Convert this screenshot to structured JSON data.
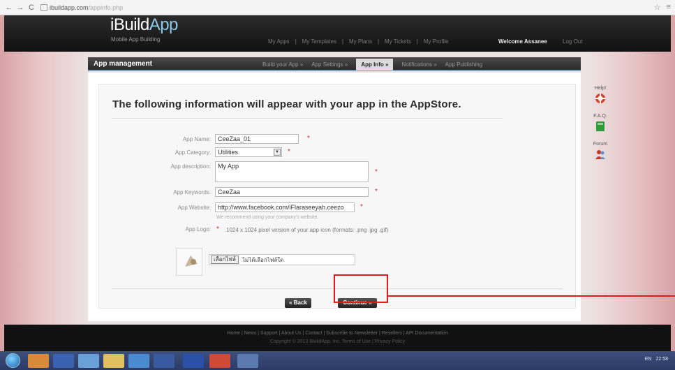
{
  "browser": {
    "url_host": "ibuildapp.com",
    "url_path": "/appinfo.php",
    "back_glyph": "←",
    "forward_glyph": "→",
    "reload_glyph": "C",
    "star_glyph": "☆",
    "menu_glyph": "≡"
  },
  "site": {
    "logo_main": "iBuild",
    "logo_accent": "App",
    "logo_sub": "Mobile App Building",
    "top_links": [
      "My Apps",
      "My Templates",
      "My Plans",
      "My Tickets",
      "My Profile"
    ],
    "welcome": "Welcome Assanee",
    "logout": "Log Out"
  },
  "management": {
    "title": "App management",
    "steps": [
      {
        "label": "Build your App »",
        "active": false
      },
      {
        "label": "App Settings »",
        "active": false
      },
      {
        "label": "App Info »",
        "active": true
      },
      {
        "label": "Notifications »",
        "active": false
      },
      {
        "label": "App Publishing",
        "active": false
      }
    ]
  },
  "form": {
    "heading": "The following information will appear with your app in the AppStore.",
    "app_name_label": "App Name:",
    "app_name_value": "CeeZaa_01",
    "category_label": "App Category:",
    "category_value": "Utilities",
    "description_label": "App description:",
    "description_value": "My App",
    "keywords_label": "App Keywords:",
    "keywords_value": "CeeZaa",
    "website_label": "App Website:",
    "website_value": "http://www.facebook.com/iFlaraseeyah.ceezo",
    "website_hint": "We recommend using your company's website.",
    "logo_label": "App Logo:",
    "logo_hint": "1024 x 1024 pixel version of your app icon (formats: .png .jpg .gif)",
    "file_button": "เลือกไฟล์",
    "file_name": "ไม่ได้เลือกไฟล์ใด",
    "required_mark": "*",
    "back_button": "« Back",
    "continue_button": "Continue »"
  },
  "side_help": [
    {
      "label": "Help!",
      "icon": "lifebuoy-icon",
      "color": "#d9402b"
    },
    {
      "label": "F.A.Q.",
      "icon": "book-icon",
      "color": "#2f9a3a"
    },
    {
      "label": "Forum",
      "icon": "people-icon",
      "color": "#c0392b"
    }
  ],
  "footer": {
    "links": "Home | News | Support | About Us | Contact | Subscribe to Newsletter | Resellers | API Documentation",
    "copyright": "Copyright © 2013 iBuildApp, Inc. Terms of Use | Privacy Policy"
  },
  "colors": {
    "highlight": "#e01b1b",
    "accent_blue": "#7da6c5"
  },
  "taskbar": {
    "tray_lang": "EN",
    "tray_time": "22:58"
  }
}
